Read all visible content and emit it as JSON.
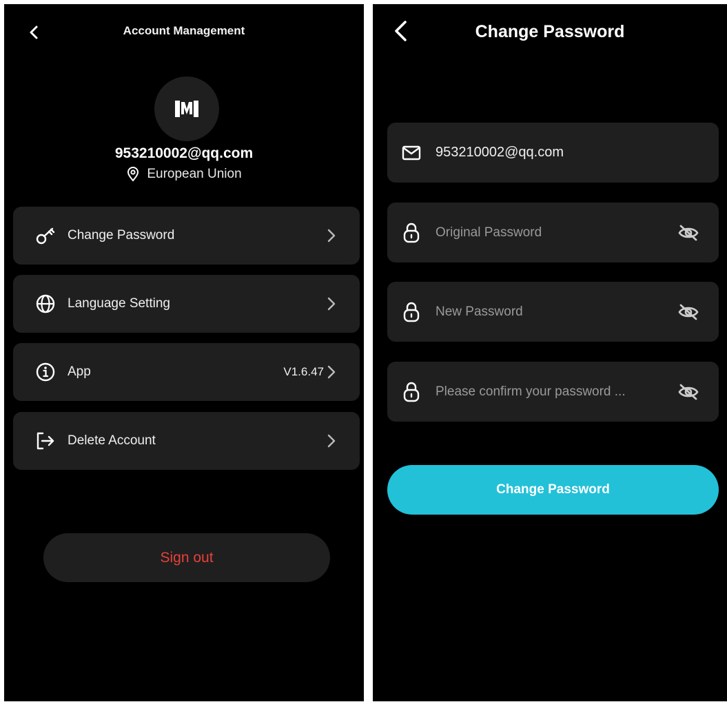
{
  "left": {
    "title": "Account Management",
    "email": "953210002@qq.com",
    "region": "European Union",
    "menu": [
      {
        "label": "Change Password",
        "value": "",
        "icon": "key-icon"
      },
      {
        "label": "Language Setting",
        "value": "",
        "icon": "globe-icon"
      },
      {
        "label": "App",
        "value": "V1.6.47",
        "icon": "info-icon"
      },
      {
        "label": "Delete Account",
        "value": "",
        "icon": "logout-icon"
      }
    ],
    "sign_out": "Sign out"
  },
  "right": {
    "title": "Change Password",
    "email": "953210002@qq.com",
    "original_placeholder": "Original Password",
    "new_placeholder": "New Password",
    "confirm_placeholder": "Please confirm your password ...",
    "button": "Change Password"
  },
  "colors": {
    "background": "#000000",
    "card": "#1f1f1f",
    "accent": "#22c1d8",
    "danger": "#e8403a"
  }
}
